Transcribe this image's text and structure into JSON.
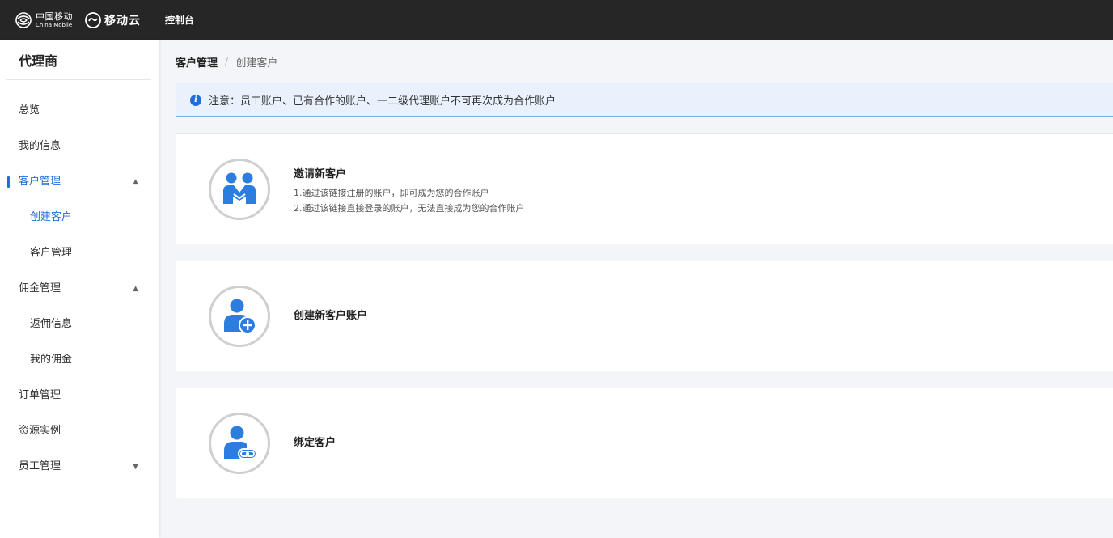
{
  "topbar": {
    "brand_cn": "中国移动",
    "brand_en": "China Mobile",
    "cloud_name": "移动云",
    "console_label": "控制台"
  },
  "sidebar": {
    "title": "代理商",
    "items": [
      {
        "label": "总览"
      },
      {
        "label": "我的信息"
      },
      {
        "label": "客户管理",
        "expanded": true,
        "active": true
      },
      {
        "label": "创建客户",
        "sub": true,
        "active": true
      },
      {
        "label": "客户管理",
        "sub": true
      },
      {
        "label": "佣金管理",
        "expanded": true
      },
      {
        "label": "返佣信息",
        "sub": true
      },
      {
        "label": "我的佣金",
        "sub": true
      },
      {
        "label": "订单管理"
      },
      {
        "label": "资源实例"
      },
      {
        "label": "员工管理",
        "expanded": false
      }
    ],
    "caret_up": "▲",
    "caret_down": "▼"
  },
  "breadcrumb": {
    "parent": "客户管理",
    "separator": "/",
    "current": "创建客户"
  },
  "notice": {
    "icon": "info-icon",
    "text": "注意：员工账户、已有合作的账户、一二级代理账户不可再次成为合作账户"
  },
  "cards": [
    {
      "title": "邀请新客户",
      "icon": "handshake-users-icon",
      "desc": [
        "1.通过该链接注册的账户，即可成为您的合作账户",
        "2.通过该链接直接登录的账户，无法直接成为您的合作账户"
      ]
    },
    {
      "title": "创建新客户账户",
      "icon": "add-user-icon",
      "desc": []
    },
    {
      "title": "绑定客户",
      "icon": "link-user-icon",
      "desc": []
    }
  ],
  "colors": {
    "accent": "#1e6fdb",
    "topbar_bg": "#262626",
    "notice_bg": "#e9f2fc",
    "notice_border": "#7aaee8",
    "page_bg": "#f3f5f8"
  }
}
